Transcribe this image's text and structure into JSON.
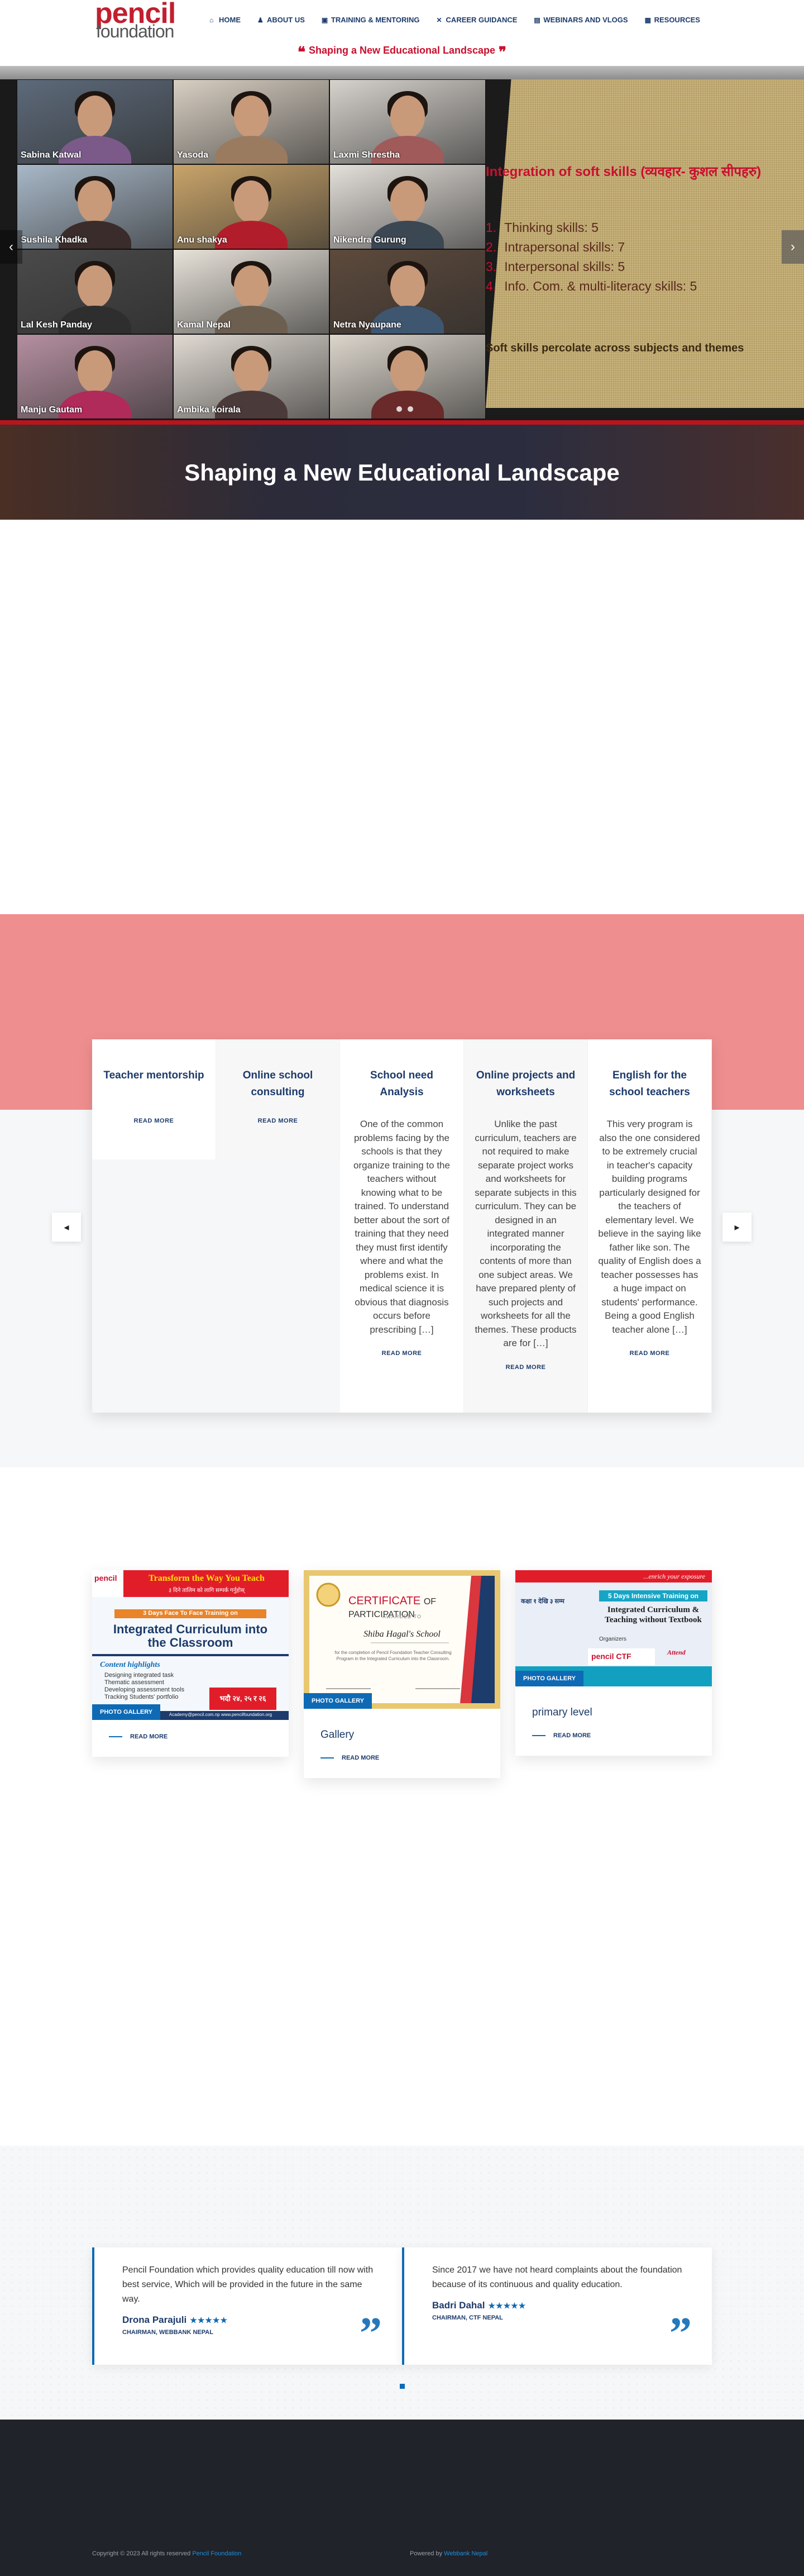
{
  "header": {
    "logo_top": "pencil",
    "logo_bottom": "foundation",
    "nav": [
      {
        "label": "Home",
        "icon": "home-icon",
        "glyph": "⌂"
      },
      {
        "label": "About Us",
        "icon": "user-icon",
        "glyph": "♟"
      },
      {
        "label": "Training & Mentoring",
        "icon": "briefcase-icon",
        "glyph": "▣"
      },
      {
        "label": "Career Guidance",
        "icon": "compass-icon",
        "glyph": "✕"
      },
      {
        "label": "Webinars and Vlogs",
        "icon": "video-icon",
        "glyph": "▤"
      },
      {
        "label": "Resources",
        "icon": "book-icon",
        "glyph": "▦"
      }
    ],
    "tagline": "Shaping a New Educational Landscape",
    "quote_open": "❝",
    "quote_close": "❞"
  },
  "slider": {
    "participants": [
      {
        "name": "Sabina Katwal"
      },
      {
        "name": "Yasoda"
      },
      {
        "name": "Laxmi Shrestha"
      },
      {
        "name": "Sushila Khadka"
      },
      {
        "name": "Anu shakya"
      },
      {
        "name": "Nikendra Gurung"
      },
      {
        "name": "Lal Kesh Panday"
      },
      {
        "name": "Kamal Nepal"
      },
      {
        "name": "Netra Nyaupane"
      },
      {
        "name": "Manju Gautam"
      },
      {
        "name": "Ambika koirala"
      },
      {
        "name": ""
      }
    ],
    "slide_title": "Integration of soft skills (व्यवहार- कुशल सीपहरु)",
    "skills": [
      {
        "num": "1.",
        "text": "Thinking skills: 5"
      },
      {
        "num": "2.",
        "text": "Intrapersonal skills: 7"
      },
      {
        "num": "3.",
        "text": "Interpersonal skills: 5"
      },
      {
        "num": "4.",
        "text": "Info. Com. & multi-literacy skills: 5"
      }
    ],
    "note": "Soft skills percolate across subjects and themes",
    "prev": "‹",
    "next": "›"
  },
  "hero": {
    "title": "Shaping a New Educational Landscape"
  },
  "services": {
    "prev": "◂",
    "next": "▸",
    "items": [
      {
        "title": "Teacher mentorship",
        "text": "",
        "more": "Read More"
      },
      {
        "title": "Online school consulting",
        "text": "",
        "more": "Read More"
      },
      {
        "title": "School need Analysis",
        "text": "One of the common problems facing by the schools is that they organize training to the teachers without knowing what to be trained. To understand better about the sort of training that they need they must first identify where and what the problems exist. In medical science it is obvious that diagnosis occurs before prescribing […]",
        "more": "Read More"
      },
      {
        "title": "Online projects and worksheets",
        "text": "Unlike the past curriculum, teachers are not required to make separate project works and worksheets for separate subjects in this curriculum. They can be designed in an integrated manner incorporating the contents of more than one subject areas. We have prepared plenty of such projects and worksheets for all the themes. These products are for […]",
        "more": "Read More"
      },
      {
        "title": "English for the school teachers",
        "text": "This very program is also the one considered to be extremely crucial in teacher's capacity building programs particularly designed for the teachers of elementary level.  We believe in the saying like father like son. The quality of English does a teacher possesses has a huge impact on students' performance. Being a good English teacher alone […]",
        "more": "Read More"
      }
    ]
  },
  "gallery": [
    {
      "badge": "Photo Gallery",
      "title": "",
      "more": "Read More",
      "poster": {
        "brand": "pencil",
        "headline": "Transform the Way You Teach",
        "sub": "३ दिने तालिम को लागि सम्पर्क गर्नुहोस्",
        "days": "3 Days Face To Face Training on",
        "main": "Integrated Curriculum into the Classroom",
        "highlights_title": "Content highlights",
        "highlights": [
          "Designing integrated task",
          "Thematic assessment",
          "Developing assessment tools",
          "Tracking Students' portfolio"
        ],
        "date": "भदौ २४, २५ र २६",
        "footer": "Academy@pencil.com.np  www.pencilfoundation.org"
      }
    },
    {
      "badge": "Photo Gallery",
      "title": "Gallery",
      "more": "Read More",
      "poster": {
        "cert_title": "CERTIFICATE",
        "cert_of": "OF PARTICIPATION",
        "awarded": "AWARDED TO",
        "school": "Shiba Hagal's School",
        "body": "for the completion of Pencil Foundation Teacher Consulting Program in the Integrated Curriculum into the Classroom."
      }
    },
    {
      "badge": "Photo Gallery",
      "title": "primary level",
      "more": "Read More",
      "poster": {
        "top": "...enrich your exposure",
        "nepali": "कक्षा १ देखि ३ सम्म",
        "days": "5 Days Intensive Training on",
        "main": "Integrated Curriculum & Teaching without Textbook",
        "org": "Organizers",
        "logos": "pencil  CTF",
        "attend": "Attend"
      }
    }
  ],
  "testimonials": [
    {
      "text": "Pencil Foundation which provides quality education till now with best service, Which will be provided in the future in the same way.",
      "name": "Drona Parajuli",
      "stars": "★★★★★",
      "role": "Chairman, Webbank Nepal"
    },
    {
      "text": "Since 2017 we have not heard complaints about the foundation because of its continuous and quality education.",
      "name": "Badri Dahal",
      "stars": "★★★★★",
      "role": "Chairman, CTF Nepal"
    }
  ],
  "footer": {
    "copyright": "Copyright © 2023 All rights reserved ",
    "copyright_link": "Pencil Foundation",
    "powered": "Powered by ",
    "powered_link": "Webbank Nepal"
  },
  "colors": {
    "brand_red": "#c8102e",
    "navy": "#1d3b6b",
    "accent_blue": "#0e6ab5",
    "pink_band": "#ef8e8f",
    "footer": "#20232a"
  }
}
